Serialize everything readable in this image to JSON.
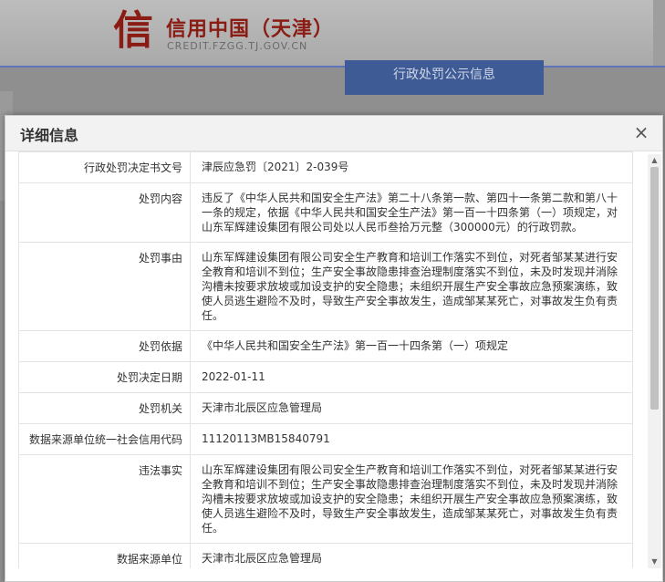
{
  "site": {
    "logo_char": "信",
    "title": "信用中国（天津）",
    "domain": "CREDIT.FZGG.TJ.GOV.CN",
    "active_tab": "行政处罚公示信息"
  },
  "modal": {
    "title": "详细信息",
    "close_label": "×",
    "rows": [
      {
        "label": "行政处罚决定书文号",
        "value": "津辰应急罚〔2021〕2-039号"
      },
      {
        "label": "处罚内容",
        "value": "违反了《中华人民共和国安全生产法》第二十八条第一款、第四十一条第二款和第八十一条的规定，依据《中华人民共和国安全生产法》第一百一十四条第（一）项规定，对山东军辉建设集团有限公司处以人民币叁拾万元整（300000元）的行政罚款。"
      },
      {
        "label": "处罚事由",
        "value": "山东军辉建设集团有限公司安全生产教育和培训工作落实不到位，对死者邹某某进行安全教育和培训不到位；生产安全事故隐患排查治理制度落实不到位，未及时发现并消除沟槽未按要求放坡或加设支护的安全隐患；未组织开展生产安全事故应急预案演练，致使人员逃生避险不及时，导致生产安全事故发生，造成邹某某死亡，对事故发生负有责任。"
      },
      {
        "label": "处罚依据",
        "value": "《中华人民共和国安全生产法》第一百一十四条第（一）项规定"
      },
      {
        "label": "处罚决定日期",
        "value": "2022-01-11"
      },
      {
        "label": "处罚机关",
        "value": "天津市北辰区应急管理局"
      },
      {
        "label": "数据来源单位统一社会信用代码",
        "value": "11120113MB15840791"
      },
      {
        "label": "违法事实",
        "value": "山东军辉建设集团有限公司安全生产教育和培训工作落实不到位，对死者邹某某进行安全教育和培训不到位；生产安全事故隐患排查治理制度落实不到位，未及时发现并消除沟槽未按要求放坡或加设支护的安全隐患；未组织开展生产安全事故应急预案演练，致使人员逃生避险不及时，导致生产安全事故发生，造成邹某某死亡，对事故发生负有责任。"
      },
      {
        "label": "数据来源单位",
        "value": "天津市北辰区应急管理局"
      }
    ]
  }
}
